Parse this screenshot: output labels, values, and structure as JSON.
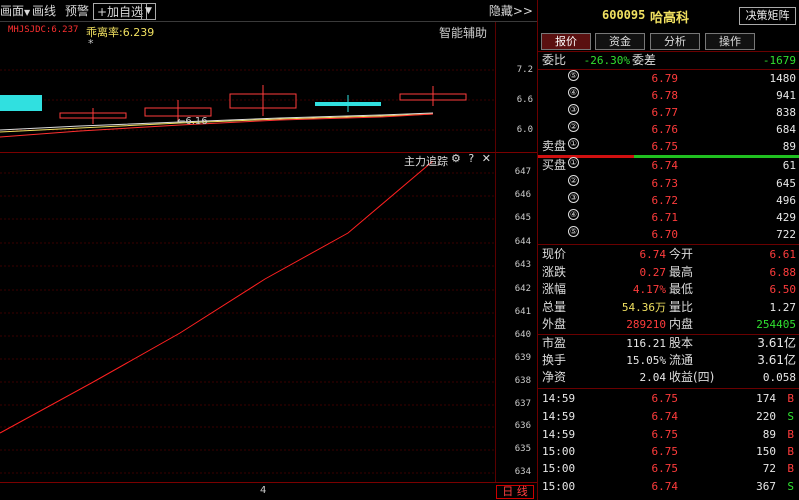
{
  "toolbar": {
    "items": [
      "画面",
      "画线",
      "预警"
    ],
    "add_watch": "+加自选",
    "hide": "隐藏>>"
  },
  "kline": {
    "legend1": "MHJSJDC:6.237",
    "legend2": "乖离率:6.239",
    "star": "*",
    "assist": "智能辅助",
    "low_label": "←6.16",
    "ticks": [
      "7.2",
      "6.6",
      "6.0"
    ]
  },
  "main": {
    "title": "主力追踪",
    "icons": "⚙ ? ✕",
    "ticks": [
      "647",
      "646",
      "645",
      "644",
      "643",
      "642",
      "641",
      "640",
      "639",
      "638",
      "637",
      "636",
      "635",
      "634"
    ]
  },
  "bottom": {
    "page": "4",
    "button": "日 线"
  },
  "quote": {
    "code": "600095",
    "name": "哈高科",
    "matrix_button": "决策矩阵",
    "tabs": [
      "报价",
      "资金",
      "分析",
      "操作"
    ],
    "weibi_label": "委比",
    "weibi": "-26.30%",
    "weicha_label": "委差",
    "weicha": "-1679",
    "sell_label": "卖盘",
    "buy_label": "买盘",
    "sells": [
      {
        "n": "⑤",
        "price": "6.79",
        "vol": "1480"
      },
      {
        "n": "④",
        "price": "6.78",
        "vol": "941"
      },
      {
        "n": "③",
        "price": "6.77",
        "vol": "838"
      },
      {
        "n": "②",
        "price": "6.76",
        "vol": "684"
      },
      {
        "n": "①",
        "price": "6.75",
        "vol": "89"
      }
    ],
    "buys": [
      {
        "n": "①",
        "price": "6.74",
        "vol": "61"
      },
      {
        "n": "②",
        "price": "6.73",
        "vol": "645"
      },
      {
        "n": "③",
        "price": "6.72",
        "vol": "496"
      },
      {
        "n": "④",
        "price": "6.71",
        "vol": "429"
      },
      {
        "n": "⑤",
        "price": "6.70",
        "vol": "722"
      }
    ],
    "stats": [
      {
        "l1": "现价",
        "v1": "6.74",
        "c1": "red",
        "l2": "今开",
        "v2": "6.61",
        "c2": "red"
      },
      {
        "l1": "涨跌",
        "v1": "0.27",
        "c1": "red",
        "l2": "最高",
        "v2": "6.88",
        "c2": "red"
      },
      {
        "l1": "涨幅",
        "v1": "4.17%",
        "c1": "red",
        "l2": "最低",
        "v2": "6.50",
        "c2": "red"
      },
      {
        "l1": "总量",
        "v1": "54.36万",
        "c1": "yellow",
        "l2": "量比",
        "v2": "1.27",
        "c2": "white"
      },
      {
        "l1": "外盘",
        "v1": "289210",
        "c1": "red",
        "l2": "内盘",
        "v2": "254405",
        "c2": "green"
      }
    ],
    "stats2": [
      {
        "l1": "市盈",
        "v1": "116.21",
        "l2": "股本",
        "v2": "3.61亿"
      },
      {
        "l1": "换手",
        "v1": "15.05%",
        "l2": "流通",
        "v2": "3.61亿"
      },
      {
        "l1": "净资",
        "v1": "2.04",
        "l2": "收益(四)",
        "v2": "0.058"
      }
    ],
    "ticks": [
      {
        "time": "14:59",
        "price": "6.75",
        "vol": "174",
        "bs": "B"
      },
      {
        "time": "14:59",
        "price": "6.74",
        "vol": "220",
        "bs": "S"
      },
      {
        "time": "14:59",
        "price": "6.75",
        "vol": "89",
        "bs": "B"
      },
      {
        "time": "15:00",
        "price": "6.75",
        "vol": "150",
        "bs": "B"
      },
      {
        "time": "15:00",
        "price": "6.75",
        "vol": "72",
        "bs": "B"
      },
      {
        "time": "15:00",
        "price": "6.74",
        "vol": "367",
        "bs": "S"
      }
    ]
  },
  "colors": {
    "up": "#ff3c3c",
    "down": "#30e030",
    "accent_yellow": "#f0e060",
    "cyan": "#30e0e0"
  }
}
